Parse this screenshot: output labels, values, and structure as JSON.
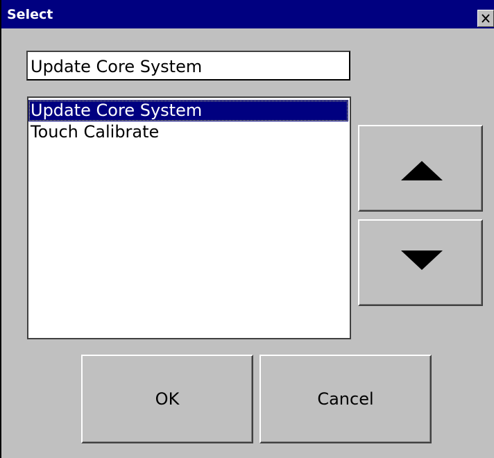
{
  "window": {
    "title": "Select"
  },
  "edit_field": {
    "value": "Update Core System"
  },
  "list": {
    "items": [
      {
        "label": "Update Core System",
        "selected": true
      },
      {
        "label": "Touch Calibrate",
        "selected": false
      }
    ]
  },
  "buttons": {
    "up_icon": "triangle-up-icon",
    "down_icon": "triangle-down-icon",
    "ok_label": "OK",
    "cancel_label": "Cancel",
    "close_icon": "close-icon"
  },
  "colors": {
    "titlebar": "#000080",
    "selection": "#000080",
    "background": "#c0c0c0"
  }
}
